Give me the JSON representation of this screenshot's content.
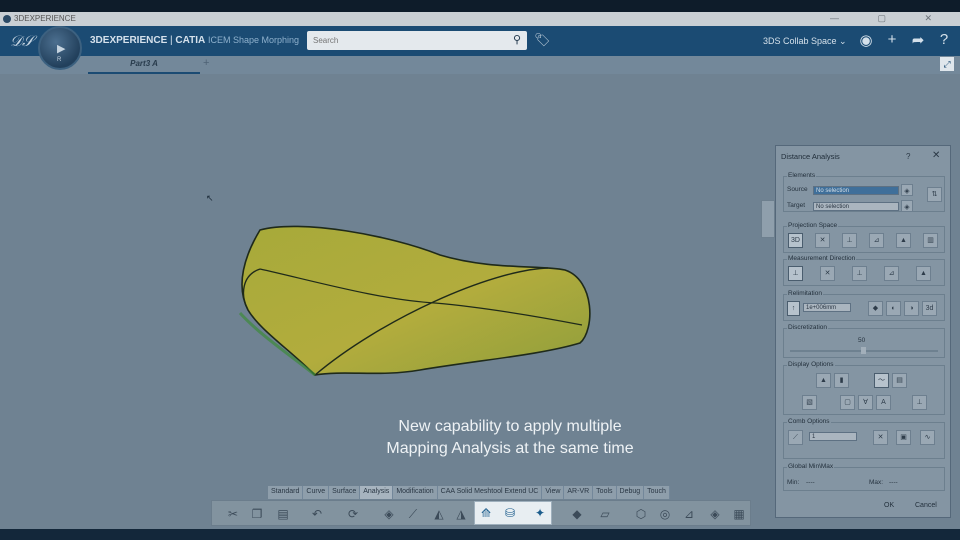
{
  "window": {
    "title": "3DEXPERIENCE",
    "controls": "— ▢ ✕"
  },
  "header": {
    "brand": "3DEXPERIENCE",
    "separator": " | ",
    "product": "CATIA",
    "app": "ICEM Shape Morphing",
    "compass_version": "R"
  },
  "search": {
    "placeholder": "Search"
  },
  "collab_space": "3DS Collab Space ⌄",
  "tabs": [
    {
      "label": "Part3 A"
    }
  ],
  "tab_add": "+",
  "caption": {
    "line1": "New capability to apply multiple",
    "line2": "Mapping Analysis at the same time"
  },
  "panel": {
    "title": "Distance Analysis",
    "help": "?",
    "close": "✕",
    "elements": {
      "label": "Elements",
      "source_label": "Source",
      "source_value": "No selection",
      "target_label": "Target",
      "target_value": "No selection"
    },
    "projection_space": {
      "label": "Projection Space",
      "btn_3d": "3D"
    },
    "measurement_direction": {
      "label": "Measurement Direction"
    },
    "relimitation": {
      "label": "Relimitation",
      "value": "1e+006mm",
      "btn_3d": "3d"
    },
    "discretization": {
      "label": "Discretization",
      "value": "50"
    },
    "display_options": {
      "label": "Display Options"
    },
    "comb_options": {
      "label": "Comb Options",
      "value": "1"
    },
    "global_minmax": {
      "label": "Global Min\\Max",
      "min_label": "Min:",
      "min_value": "----",
      "max_label": "Max:",
      "max_value": "----"
    },
    "ok": "OK",
    "cancel": "Cancel"
  },
  "action_bar": {
    "tabs": [
      "Standard",
      "Curve",
      "Surface",
      "Analysis",
      "Modification",
      "CAA Solid Meshtool Extend UC",
      "View",
      "AR-VR",
      "Tools",
      "Debug",
      "Touch"
    ],
    "active_tab": "Analysis"
  },
  "colors": {
    "header": "#1b4b73",
    "surface": "#a8a83c",
    "panel": "#8495a3",
    "caption": "#eef2f5"
  }
}
